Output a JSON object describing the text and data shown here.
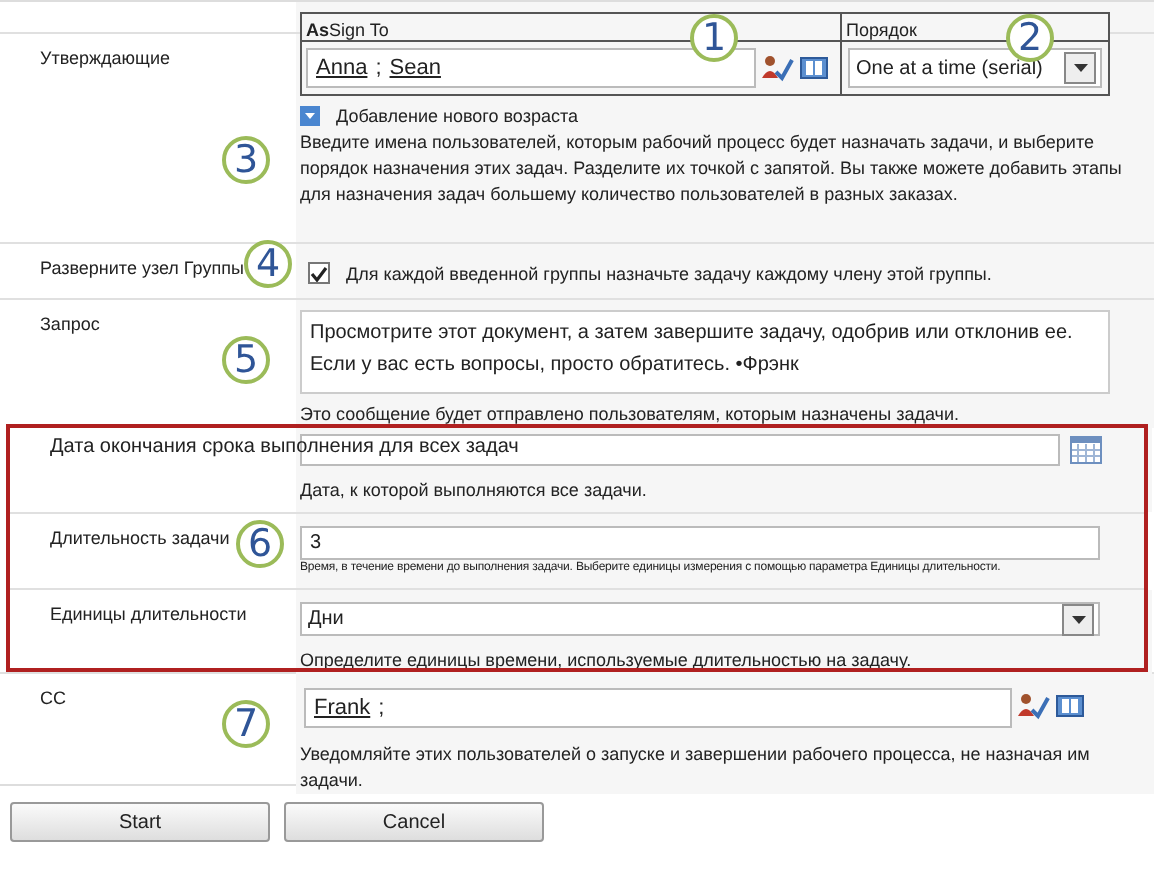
{
  "approvers": {
    "label": "Утверждающие",
    "assign_header": "**As**Sign To",
    "order_header": "Порядок",
    "people": [
      {
        "name": "Anna"
      },
      {
        "name": "Sean"
      }
    ],
    "separator": ";",
    "order_value": "One at a time (serial)",
    "add_stage": "Добавление нового возраста",
    "help": "Введите имена пользователей, которым рабочий процесс будет назначать задачи, и выберите порядок назначения этих задач. Разделите их точкой с запятой. Вы также можете добавить этапы для назначения задач большему количество пользователей в разных заказах."
  },
  "expand_groups": {
    "label": "Разверните узел Группы",
    "checked": true,
    "text": "Для каждой введенной группы назначьте задачу каждому члену этой группы."
  },
  "request": {
    "label": "Запрос",
    "value": "Просмотрите этот документ, а затем завершите задачу, одобрив или отклонив ее. Если у вас есть вопросы, просто обратитесь. •Фрэнк",
    "help": "Это сообщение будет отправлено пользователям, которым назначены задачи."
  },
  "highlighted_rows": [
    {
      "kind": "date",
      "label": "Дата окончания срока выполнения для всех задач",
      "help": "Дата, к которой выполняются все задачи."
    },
    {
      "kind": "text",
      "label": "Длительность задачи",
      "value": "3",
      "help": "Время, в течение времени до выполнения задачи. Выберите единицы измерения с помощью параметра Единицы длительности."
    },
    {
      "kind": "select",
      "label": "Единицы длительности",
      "value": "Дни",
      "help": "Определите единицы времени,  используемые длительностью на задачу."
    }
  ],
  "cc": {
    "label": "CC",
    "people": [
      {
        "name": "Frank"
      }
    ],
    "separator": ";",
    "help": "Уведомляйте этих пользователей о запуске и завершении рабочего процесса, не назначая им задачи."
  },
  "buttons": [
    "Start",
    "Cancel"
  ],
  "callouts": [
    "1",
    "2",
    "3",
    "4",
    "5",
    "6",
    "7"
  ]
}
